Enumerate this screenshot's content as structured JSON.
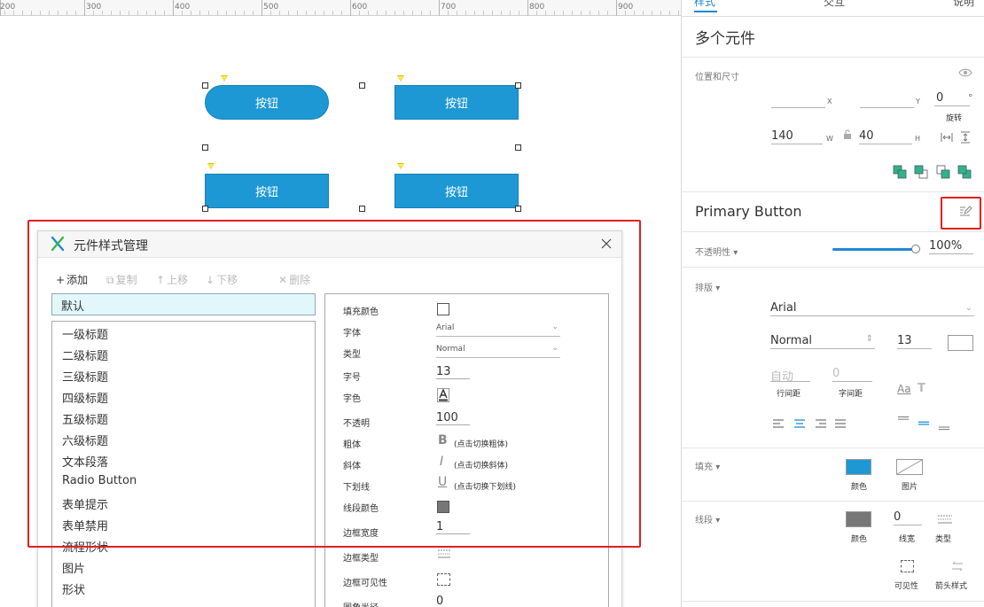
{
  "ruler": {
    "ticks": [
      "200",
      "300",
      "400",
      "500",
      "600",
      "700",
      "800",
      "900"
    ]
  },
  "canvas": {
    "buttons": [
      "按钮",
      "按钮",
      "按钮",
      "按钮"
    ]
  },
  "dialog": {
    "title": "元件样式管理",
    "toolbar": {
      "add": "添加",
      "copy": "复制",
      "up": "上移",
      "down": "下移",
      "delete": "删除"
    },
    "default_style": "默认",
    "styles": [
      "一级标题",
      "二级标题",
      "三级标题",
      "四级标题",
      "五级标题",
      "六级标题",
      "文本段落",
      "Radio Button",
      "表单提示",
      "表单禁用",
      "流程形状",
      "图片",
      "形状"
    ],
    "props": {
      "fill_color": "填充颜色",
      "font": "字体",
      "font_value": "Arial",
      "type": "类型",
      "type_value": "Normal",
      "font_size": "字号",
      "font_size_value": "13",
      "font_color": "字色",
      "opacity": "不透明",
      "opacity_value": "100",
      "bold": "粗体",
      "bold_hint": "(点击切换粗体)",
      "italic": "斜体",
      "italic_hint": "(点击切换斜体)",
      "underline": "下划线",
      "underline_hint": "(点击切换下划线)",
      "line_color": "线段颜色",
      "border_width": "边框宽度",
      "border_width_value": "1",
      "border_type": "边框类型",
      "border_visibility": "边框可见性",
      "corner_radius": "圆角半径",
      "corner_radius_value": "0"
    }
  },
  "panel": {
    "tabs": [
      "样式",
      "交互",
      "说明"
    ],
    "title": "多个元件",
    "position_size": "位置和尺寸",
    "x_value": "",
    "x_unit": "X",
    "y_value": "",
    "y_unit": "Y",
    "rotation_value": "0",
    "rotation_unit": "°",
    "rotation_label": "旋转",
    "w_value": "140",
    "w_unit": "W",
    "h_value": "40",
    "h_unit": "H",
    "style_name": "Primary Button",
    "opacity_label": "不透明性",
    "opacity_value": "100%",
    "typography_label": "排版",
    "font_value": "Arial",
    "weight_value": "Normal",
    "size_value": "13",
    "line_height_value": "自动",
    "line_height_label": "行间距",
    "char_spacing_value": "0",
    "char_spacing_label": "字间距",
    "fill_label": "填充",
    "fill_color_label": "颜色",
    "fill_image_label": "图片",
    "stroke_label": "线段",
    "stroke_color_label": "颜色",
    "stroke_width_value": "0",
    "stroke_width_label": "线宽",
    "stroke_type_label": "类型",
    "visibility_label": "可见性",
    "arrow_style_label": "箭头样式",
    "colors": {
      "fill": "#1e98d4",
      "stroke": "#777777",
      "accent": "#1e88d4",
      "highlight": "#e02020"
    }
  }
}
